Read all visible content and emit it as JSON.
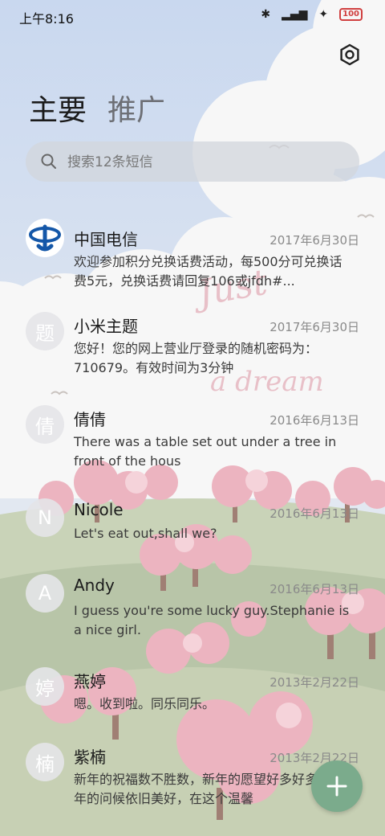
{
  "status_bar": {
    "time": "上午8:16",
    "battery": "100"
  },
  "tabs": [
    {
      "label": "主要"
    },
    {
      "label": "推广"
    }
  ],
  "search": {
    "placeholder": "搜索12条短信"
  },
  "messages": [
    {
      "avatar": "",
      "name": "中国电信",
      "date": "2017年6月30日",
      "preview": "欢迎参加积分兑换话费活动，每500分可兑换话费5元，兑换话费请回复106或jfdh#..."
    },
    {
      "avatar": "题",
      "name": "小米主题",
      "date": "2017年6月30日",
      "preview": "您好！您的网上营业厅登录的随机密码为：710679。有效时间为3分钟"
    },
    {
      "avatar": "倩",
      "name": "倩倩",
      "date": "2016年6月13日",
      "preview": "There was a table set out under a tree in front of the hous"
    },
    {
      "avatar": "N",
      "name": "Nicole",
      "date": "2016年6月13日",
      "preview": "Let's eat out,shall we?"
    },
    {
      "avatar": "A",
      "name": "Andy",
      "date": "2016年6月13日",
      "preview": "I guess you're some lucky guy.Stephanie is a nice girl."
    },
    {
      "avatar": "婷",
      "name": "燕婷",
      "date": "2013年2月22日",
      "preview": "嗯。收到啦。同乐同乐。"
    },
    {
      "avatar": "楠",
      "name": "紫楠",
      "date": "2013年2月22日",
      "preview": "新年的祝福数不胜数，新年的愿望好多好多，新年的问候依旧美好，在这个温馨"
    }
  ],
  "wallpaper_text": [
    "Just",
    "a dream"
  ]
}
